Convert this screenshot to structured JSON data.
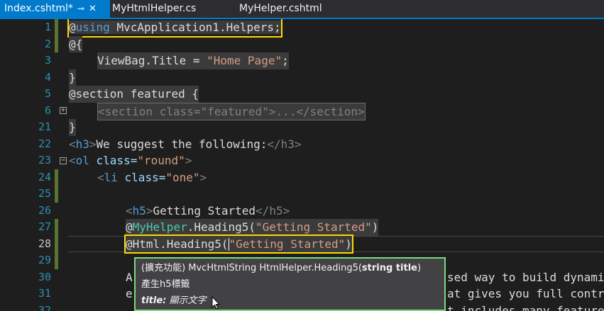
{
  "tabs": [
    {
      "label": "Index.cshtml*",
      "active": true
    },
    {
      "label": "MyHtmlHelper.cs",
      "active": false
    },
    {
      "label": "MyHelper.cshtml",
      "active": false
    }
  ],
  "lines": [
    {
      "n": "1",
      "code": {
        "at": "@",
        "kw": "using",
        "rest": " MvcApplication1.Helpers;"
      }
    },
    {
      "n": "2",
      "code": {
        "text": "@{"
      }
    },
    {
      "n": "3",
      "code": {
        "a": "ViewBag.Title = ",
        "s": "\"Home Page\"",
        "b": ";"
      }
    },
    {
      "n": "4",
      "code": {
        "text": "}"
      }
    },
    {
      "n": "5",
      "code": {
        "text": "@section featured {"
      }
    },
    {
      "n": "6",
      "code": {
        "text": "<section class=\"featured\">...</section>"
      }
    },
    {
      "n": "21",
      "code": {
        "text": "}"
      }
    },
    {
      "n": "22",
      "code": {
        "lt": "<",
        "tag": "h3",
        "gt": ">",
        "content": "We suggest the following:",
        "close": "</h3>"
      }
    },
    {
      "n": "23",
      "code": {
        "lt": "<",
        "tag": "ol",
        "attr": " class=",
        "val": "\"round\"",
        "gt": ">"
      }
    },
    {
      "n": "24",
      "code": {
        "lt": "<",
        "tag": "li",
        "attr": " class=",
        "val": "\"one\"",
        "gt": ">"
      }
    },
    {
      "n": "25",
      "code": {
        "text": ""
      }
    },
    {
      "n": "26",
      "code": {
        "lt": "<",
        "tag": "h5",
        "gt": ">",
        "content": "Getting Started",
        "close": "</h5>"
      }
    },
    {
      "n": "27",
      "code": {
        "at": "@",
        "type": "MyHelper",
        "rest": ".Heading5(",
        "s": "\"Getting Started\"",
        "end": ")"
      }
    },
    {
      "n": "28",
      "code": {
        "at": "@",
        "rest": "Html.Heading5(",
        "s": "\"Getting Started\"",
        "end": ")"
      }
    },
    {
      "n": "29",
      "code": {
        "text": ""
      }
    },
    {
      "n": "30",
      "code": {
        "text": "A",
        "tail": "sed way to build dynami"
      }
    },
    {
      "n": "31",
      "code": {
        "text": "e",
        "tail": "at gives you full contr"
      }
    },
    {
      "n": "32",
      "code": {
        "text": "",
        "tail": "t includes many feature"
      }
    }
  ],
  "tooltip": {
    "signature_prefix": "(擴充功能) MvcHtmlString HtmlHelper.Heading5(",
    "param_bold": "string title",
    "signature_suffix": ")",
    "description": "產生h5標籤",
    "param_name": "title:",
    "param_desc": " 顯示文字"
  },
  "colors": {
    "accent": "#007acc",
    "yellow_highlight": "#ffd800",
    "green_highlight": "#7dd87d"
  }
}
